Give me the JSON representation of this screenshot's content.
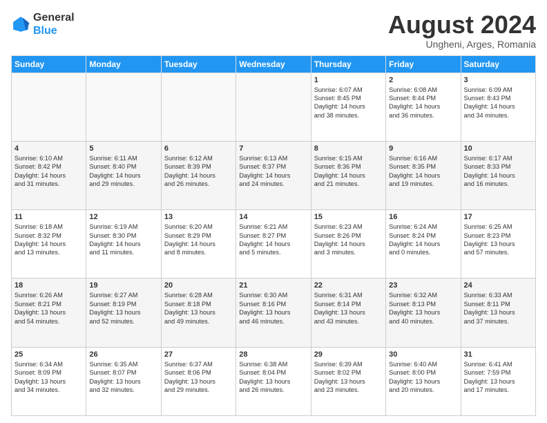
{
  "logo": {
    "line1": "General",
    "line2": "Blue"
  },
  "title": "August 2024",
  "subtitle": "Ungheni, Arges, Romania",
  "days_of_week": [
    "Sunday",
    "Monday",
    "Tuesday",
    "Wednesday",
    "Thursday",
    "Friday",
    "Saturday"
  ],
  "weeks": [
    [
      {
        "day": "",
        "info": ""
      },
      {
        "day": "",
        "info": ""
      },
      {
        "day": "",
        "info": ""
      },
      {
        "day": "",
        "info": ""
      },
      {
        "day": "1",
        "info": "Sunrise: 6:07 AM\nSunset: 8:45 PM\nDaylight: 14 hours\nand 38 minutes."
      },
      {
        "day": "2",
        "info": "Sunrise: 6:08 AM\nSunset: 8:44 PM\nDaylight: 14 hours\nand 36 minutes."
      },
      {
        "day": "3",
        "info": "Sunrise: 6:09 AM\nSunset: 8:43 PM\nDaylight: 14 hours\nand 34 minutes."
      }
    ],
    [
      {
        "day": "4",
        "info": "Sunrise: 6:10 AM\nSunset: 8:42 PM\nDaylight: 14 hours\nand 31 minutes."
      },
      {
        "day": "5",
        "info": "Sunrise: 6:11 AM\nSunset: 8:40 PM\nDaylight: 14 hours\nand 29 minutes."
      },
      {
        "day": "6",
        "info": "Sunrise: 6:12 AM\nSunset: 8:39 PM\nDaylight: 14 hours\nand 26 minutes."
      },
      {
        "day": "7",
        "info": "Sunrise: 6:13 AM\nSunset: 8:37 PM\nDaylight: 14 hours\nand 24 minutes."
      },
      {
        "day": "8",
        "info": "Sunrise: 6:15 AM\nSunset: 8:36 PM\nDaylight: 14 hours\nand 21 minutes."
      },
      {
        "day": "9",
        "info": "Sunrise: 6:16 AM\nSunset: 8:35 PM\nDaylight: 14 hours\nand 19 minutes."
      },
      {
        "day": "10",
        "info": "Sunrise: 6:17 AM\nSunset: 8:33 PM\nDaylight: 14 hours\nand 16 minutes."
      }
    ],
    [
      {
        "day": "11",
        "info": "Sunrise: 6:18 AM\nSunset: 8:32 PM\nDaylight: 14 hours\nand 13 minutes."
      },
      {
        "day": "12",
        "info": "Sunrise: 6:19 AM\nSunset: 8:30 PM\nDaylight: 14 hours\nand 11 minutes."
      },
      {
        "day": "13",
        "info": "Sunrise: 6:20 AM\nSunset: 8:29 PM\nDaylight: 14 hours\nand 8 minutes."
      },
      {
        "day": "14",
        "info": "Sunrise: 6:21 AM\nSunset: 8:27 PM\nDaylight: 14 hours\nand 5 minutes."
      },
      {
        "day": "15",
        "info": "Sunrise: 6:23 AM\nSunset: 8:26 PM\nDaylight: 14 hours\nand 3 minutes."
      },
      {
        "day": "16",
        "info": "Sunrise: 6:24 AM\nSunset: 8:24 PM\nDaylight: 14 hours\nand 0 minutes."
      },
      {
        "day": "17",
        "info": "Sunrise: 6:25 AM\nSunset: 8:23 PM\nDaylight: 13 hours\nand 57 minutes."
      }
    ],
    [
      {
        "day": "18",
        "info": "Sunrise: 6:26 AM\nSunset: 8:21 PM\nDaylight: 13 hours\nand 54 minutes."
      },
      {
        "day": "19",
        "info": "Sunrise: 6:27 AM\nSunset: 8:19 PM\nDaylight: 13 hours\nand 52 minutes."
      },
      {
        "day": "20",
        "info": "Sunrise: 6:28 AM\nSunset: 8:18 PM\nDaylight: 13 hours\nand 49 minutes."
      },
      {
        "day": "21",
        "info": "Sunrise: 6:30 AM\nSunset: 8:16 PM\nDaylight: 13 hours\nand 46 minutes."
      },
      {
        "day": "22",
        "info": "Sunrise: 6:31 AM\nSunset: 8:14 PM\nDaylight: 13 hours\nand 43 minutes."
      },
      {
        "day": "23",
        "info": "Sunrise: 6:32 AM\nSunset: 8:13 PM\nDaylight: 13 hours\nand 40 minutes."
      },
      {
        "day": "24",
        "info": "Sunrise: 6:33 AM\nSunset: 8:11 PM\nDaylight: 13 hours\nand 37 minutes."
      }
    ],
    [
      {
        "day": "25",
        "info": "Sunrise: 6:34 AM\nSunset: 8:09 PM\nDaylight: 13 hours\nand 34 minutes."
      },
      {
        "day": "26",
        "info": "Sunrise: 6:35 AM\nSunset: 8:07 PM\nDaylight: 13 hours\nand 32 minutes."
      },
      {
        "day": "27",
        "info": "Sunrise: 6:37 AM\nSunset: 8:06 PM\nDaylight: 13 hours\nand 29 minutes."
      },
      {
        "day": "28",
        "info": "Sunrise: 6:38 AM\nSunset: 8:04 PM\nDaylight: 13 hours\nand 26 minutes."
      },
      {
        "day": "29",
        "info": "Sunrise: 6:39 AM\nSunset: 8:02 PM\nDaylight: 13 hours\nand 23 minutes."
      },
      {
        "day": "30",
        "info": "Sunrise: 6:40 AM\nSunset: 8:00 PM\nDaylight: 13 hours\nand 20 minutes."
      },
      {
        "day": "31",
        "info": "Sunrise: 6:41 AM\nSunset: 7:59 PM\nDaylight: 13 hours\nand 17 minutes."
      }
    ]
  ]
}
